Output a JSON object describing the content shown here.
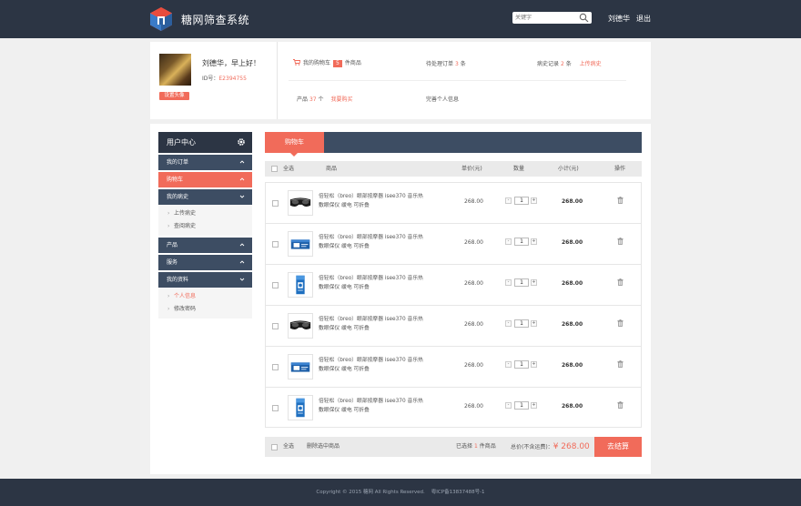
{
  "header": {
    "brand": "糖网筛查系统",
    "search_placeholder": "关键字",
    "user_name": "刘德华",
    "logout_label": "退出"
  },
  "profile": {
    "greeting": "刘德华，早上好！",
    "id_label": "ID号：",
    "id_value": "E2394755",
    "set_avatar_label": "设置头像",
    "cart_label": "我的购物车",
    "cart_count": "5",
    "cart_unit": "件商品",
    "pending_label": "待处理订单",
    "pending_count": "3",
    "pending_unit": "条",
    "history_label": "病史记录",
    "history_count": "2",
    "history_unit": "条",
    "upload_history_link": "上传病史",
    "products_label": "产品",
    "products_count": "37",
    "products_unit": "个",
    "want_buy_link": "我要购买",
    "complete_info_link": "完善个人信息"
  },
  "sidebar": {
    "title": "用户中心",
    "items": [
      {
        "label": "我的订单"
      },
      {
        "label": "购物车"
      },
      {
        "label": "我的病史",
        "sub": [
          "上传病史",
          "查阅病史"
        ]
      },
      {
        "label": "产品"
      },
      {
        "label": "服务"
      },
      {
        "label": "我的资料",
        "sub": [
          "个人信息",
          "修改密码"
        ]
      }
    ]
  },
  "cart": {
    "tab_label": "购物车",
    "columns": {
      "select_all": "全选",
      "product": "商品",
      "unit_price": "单价(元)",
      "quantity": "数量",
      "subtotal": "小计(元)",
      "action": "操作"
    },
    "rows": [
      {
        "name_line1": "倍轻松（breo）眼部按摩器 isee370 音乐热",
        "name_line2": "敷眼保仪 缓电 可折叠",
        "price": "268.00",
        "qty": "1",
        "subtotal": "268.00",
        "thumb": "goggles"
      },
      {
        "name_line1": "倍轻松（breo）眼部按摩器 isee370 音乐热",
        "name_line2": "敷眼保仪 缓电 可折叠",
        "price": "268.00",
        "qty": "1",
        "subtotal": "268.00",
        "thumb": "box"
      },
      {
        "name_line1": "倍轻松（breo）眼部按摩器 isee370 音乐热",
        "name_line2": "敷眼保仪 缓电 可折叠",
        "price": "268.00",
        "qty": "1",
        "subtotal": "268.00",
        "thumb": "tall-box"
      },
      {
        "name_line1": "倍轻松（breo）眼部按摩器 isee370 音乐热",
        "name_line2": "敷眼保仪 缓电 可折叠",
        "price": "268.00",
        "qty": "1",
        "subtotal": "268.00",
        "thumb": "goggles"
      },
      {
        "name_line1": "倍轻松（breo）眼部按摩器 isee370 音乐热",
        "name_line2": "敷眼保仪 缓电 可折叠",
        "price": "268.00",
        "qty": "1",
        "subtotal": "268.00",
        "thumb": "box"
      },
      {
        "name_line1": "倍轻松（breo）眼部按摩器 isee370 音乐热",
        "name_line2": "敷眼保仪 缓电 可折叠",
        "price": "268.00",
        "qty": "1",
        "subtotal": "268.00",
        "thumb": "tall-box"
      }
    ],
    "footer": {
      "select_all": "全选",
      "delete_selected": "删除选中商品",
      "selected_prefix": "已选择",
      "selected_count": "1",
      "selected_suffix": "件商品",
      "total_label": "总价(不含运费)：",
      "total_value": "¥ 268.00",
      "checkout_label": "去结算"
    }
  },
  "footer": {
    "copyright": "Copyright © 2015 糖网 All Rights Reserved.    粤ICP备13837488号-1"
  },
  "colors": {
    "accent": "#f16b5a",
    "dark": "#2c3544",
    "nav": "#3d4d63"
  }
}
